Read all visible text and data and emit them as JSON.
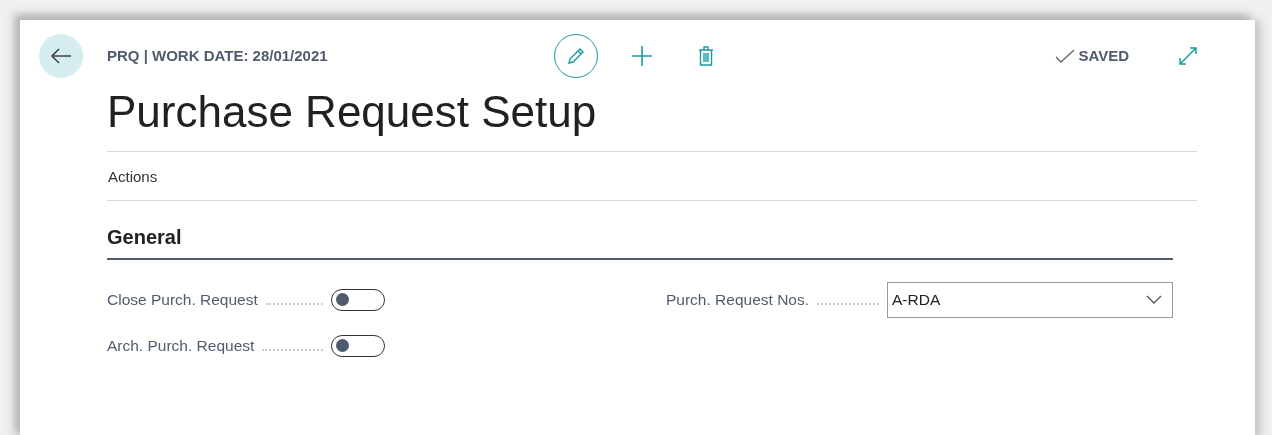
{
  "header": {
    "caption": "PRQ | WORK DATE: 28/01/2021",
    "status": "SAVED"
  },
  "title": "Purchase Request Setup",
  "actions_label": "Actions",
  "section": {
    "title": "General"
  },
  "left_fields": [
    {
      "label": "Close Purch. Request",
      "kind": "toggle",
      "on": false
    },
    {
      "label": "Arch. Purch. Request",
      "kind": "toggle",
      "on": false
    }
  ],
  "right_fields": [
    {
      "label": "Purch. Request Nos.",
      "kind": "dropdown",
      "value": "A-RDA"
    }
  ]
}
